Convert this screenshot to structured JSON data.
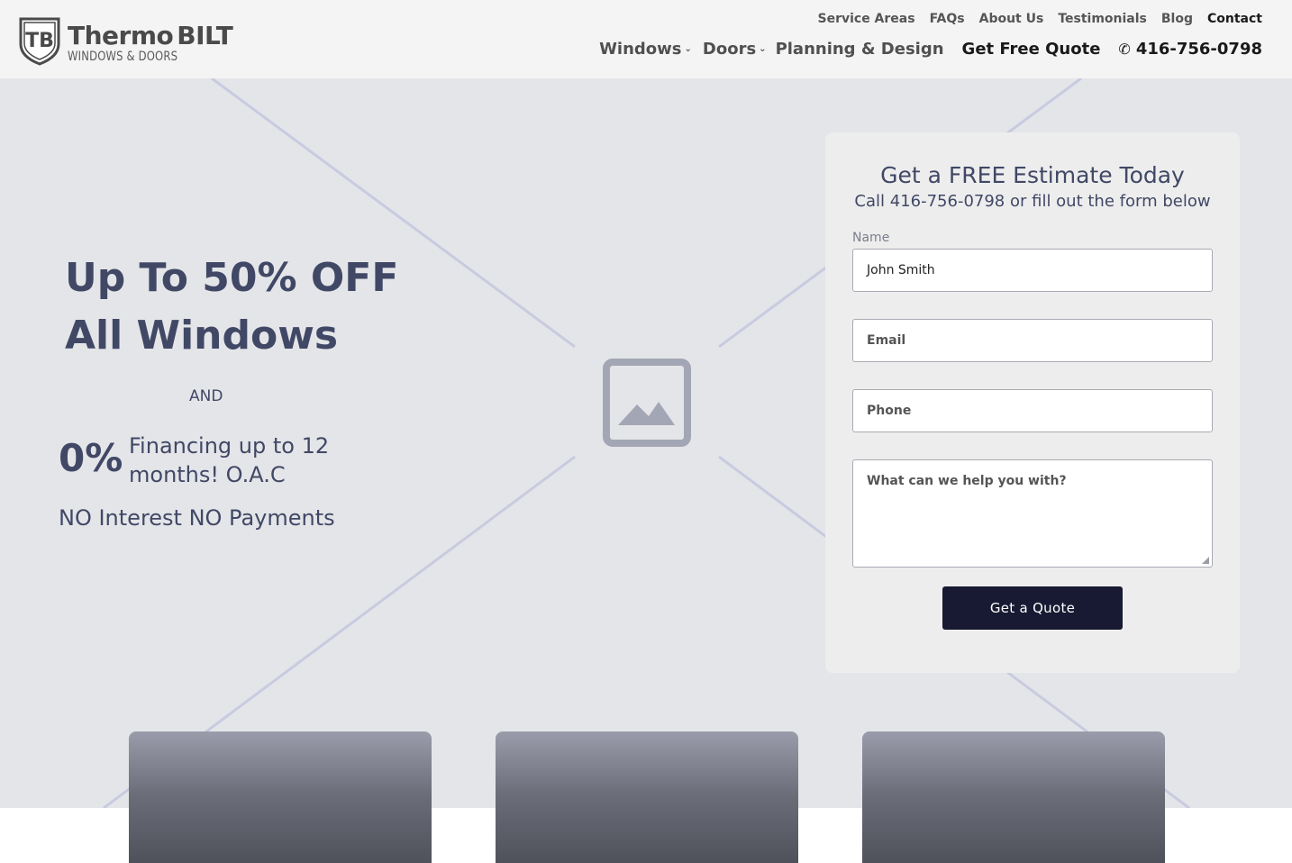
{
  "brand": {
    "logo_mark": "TB",
    "name_part1": "Thermo",
    "name_part2": "BILT",
    "tagline": "WINDOWS & DOORS"
  },
  "top_nav": [
    "Service Areas",
    "FAQs",
    "About Us",
    "Testimonials",
    "Blog",
    "Contact"
  ],
  "main_nav": {
    "windows": "Windows",
    "doors": "Doors",
    "planning": "Planning & Design",
    "quote": "Get Free Quote",
    "phone": "416-756-0798"
  },
  "promo": {
    "line1": "Up To 50% OFF",
    "line2": "All Windows",
    "and": "AND",
    "rate": "0%",
    "financing": "Financing up to 12 months! O.A.C",
    "no_pay": "NO Interest NO Payments"
  },
  "form": {
    "title": "Get a FREE Estimate Today",
    "subtitle": "Call 416-756-0798 or fill out the form below",
    "name_label": "Name",
    "name_value": "John Smith",
    "email_placeholder": "Email",
    "phone_placeholder": "Phone",
    "message_placeholder": "What can we help you with?",
    "submit_label": "Get a Quote"
  },
  "icons": {
    "phone": "phone-icon",
    "chevron": "chevron-down-icon",
    "placeholder": "image-placeholder-icon"
  },
  "colors": {
    "accent_dark": "#181a33",
    "text_primary": "#414866",
    "hero_bg": "#e4e5e8"
  }
}
